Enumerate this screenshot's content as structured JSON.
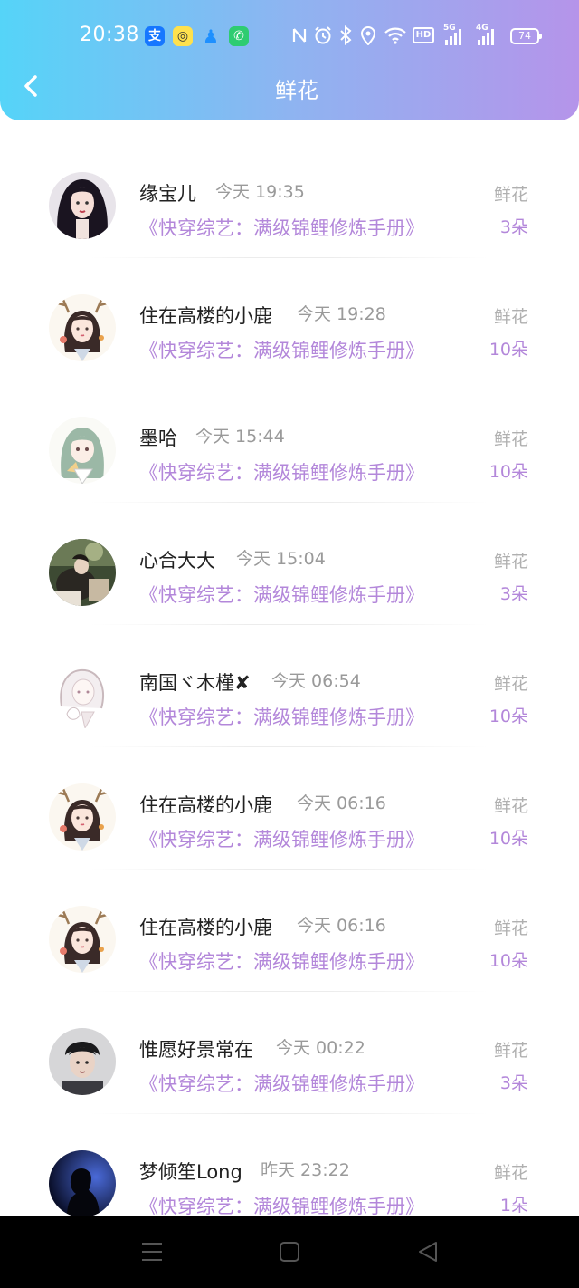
{
  "status_bar": {
    "time": "20:38",
    "network_5g": "5G",
    "network_4g": "4G",
    "hd": "HD",
    "battery": "74"
  },
  "header": {
    "title": "鲜花"
  },
  "list": [
    {
      "name": "缘宝儿",
      "time": "今天 19:35",
      "book": "《快穿综艺：满级锦鲤修炼手册》",
      "label": "鲜花",
      "count": "3朵",
      "avatar": "dark-hair-girl"
    },
    {
      "name": "住在高楼的小鹿",
      "time": "今天 19:28",
      "book": "《快穿综艺：满级锦鲤修炼手册》",
      "label": "鲜花",
      "count": "10朵",
      "avatar": "antler-girl"
    },
    {
      "name": "墨哈",
      "time": "今天 15:44",
      "book": "《快穿综艺：满级锦鲤修炼手册》",
      "label": "鲜花",
      "count": "10朵",
      "avatar": "green-hair-girl"
    },
    {
      "name": "心合大大",
      "time": "今天 15:04",
      "book": "《快穿综艺：满级锦鲤修炼手册》",
      "label": "鲜花",
      "count": "3朵",
      "avatar": "photo-outdoor"
    },
    {
      "name": "南国ヾ木槿✘",
      "time": "今天 06:54",
      "book": "《快穿综艺：满级锦鲤修炼手册》",
      "label": "鲜花",
      "count": "10朵",
      "avatar": "sketch-boy"
    },
    {
      "name": "住在高楼的小鹿",
      "time": "今天 06:16",
      "book": "《快穿综艺：满级锦鲤修炼手册》",
      "label": "鲜花",
      "count": "10朵",
      "avatar": "antler-girl"
    },
    {
      "name": "住在高楼的小鹿",
      "time": "今天 06:16",
      "book": "《快穿综艺：满级锦鲤修炼手册》",
      "label": "鲜花",
      "count": "10朵",
      "avatar": "antler-girl"
    },
    {
      "name": "惟愿好景常在",
      "time": "今天 00:22",
      "book": "《快穿综艺：满级锦鲤修炼手册》",
      "label": "鲜花",
      "count": "3朵",
      "avatar": "boy-portrait"
    },
    {
      "name": "梦倾笙Long",
      "time": "昨天 23:22",
      "book": "《快穿综艺：满级锦鲤修炼手册》",
      "label": "鲜花",
      "count": "1朵",
      "avatar": "silhouette"
    }
  ]
}
